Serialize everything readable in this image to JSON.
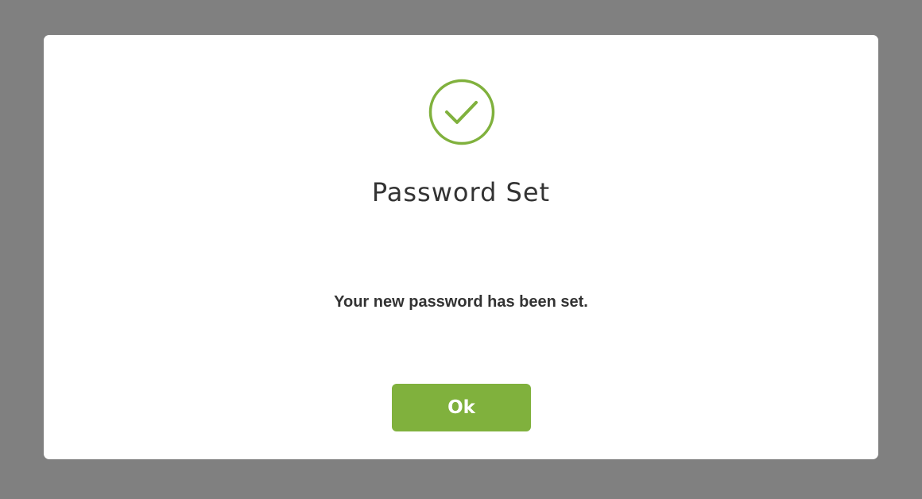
{
  "modal": {
    "title": "Password Set",
    "message": "Your new password has been set.",
    "ok_label": "Ok",
    "icon": "check-circle-icon"
  },
  "colors": {
    "overlay": "#808080",
    "dialog_background": "#ffffff",
    "accent": "#80b13d",
    "text": "#333333",
    "button_text": "#ffffff"
  }
}
